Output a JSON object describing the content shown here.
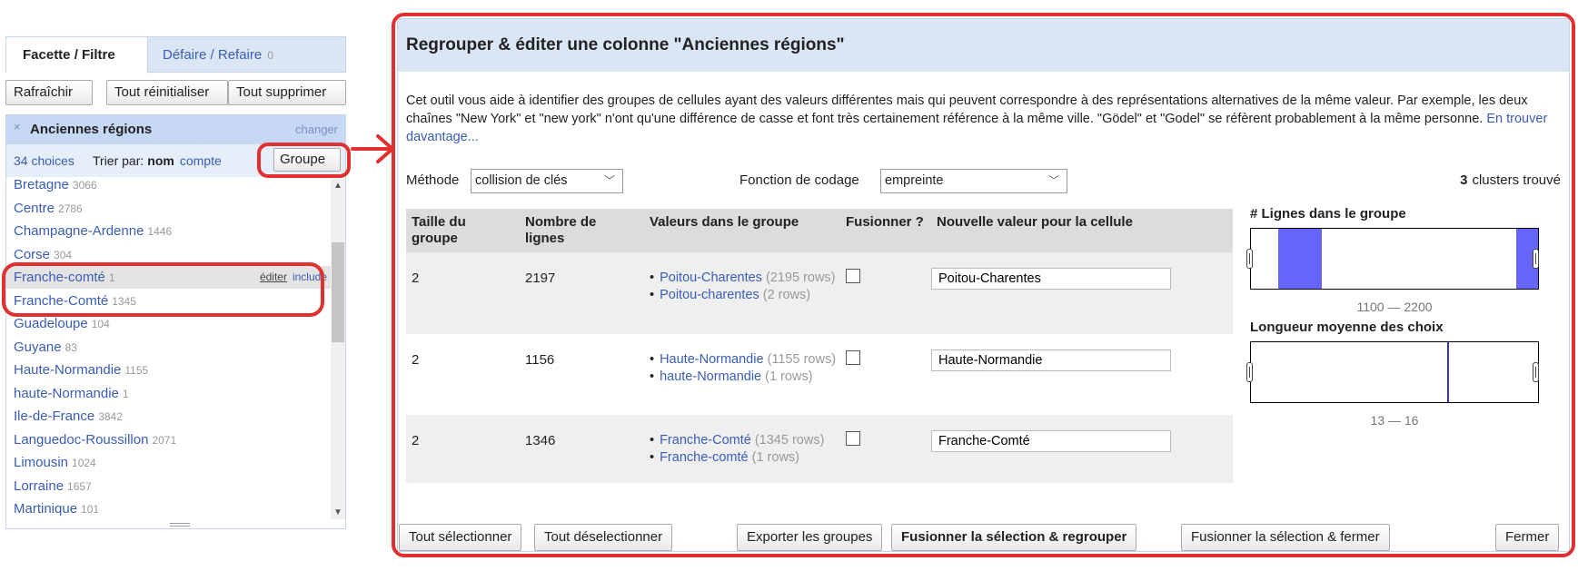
{
  "left_panel": {
    "tabs": {
      "active": "Facette / Filtre",
      "other": "Défaire / Refaire",
      "other_count": "0"
    },
    "buttons": {
      "refresh": "Rafraîchir",
      "reset_all": "Tout réinitialiser",
      "remove_all": "Tout supprimer"
    },
    "facet": {
      "close_icon": "×",
      "title": "Anciennes régions",
      "change": "changer",
      "choices": "34 choices",
      "sort_label": "Trier par:",
      "sort_name": "nom",
      "sort_count": "compte",
      "group_button": "Groupe",
      "items": [
        {
          "label": "Bretagne",
          "count": "3066"
        },
        {
          "label": "Centre",
          "count": "2786"
        },
        {
          "label": "Champagne-Ardenne",
          "count": "1446"
        },
        {
          "label": "Corse",
          "count": "304"
        },
        {
          "label": "Franche-comté",
          "count": "1",
          "edit": "éditer",
          "include": "include"
        },
        {
          "label": "Franche-Comté",
          "count": "1345"
        },
        {
          "label": "Guadeloupe",
          "count": "104"
        },
        {
          "label": "Guyane",
          "count": "83"
        },
        {
          "label": "Haute-Normandie",
          "count": "1155"
        },
        {
          "label": "haute-Normandie",
          "count": "1"
        },
        {
          "label": "Ile-de-France",
          "count": "3842"
        },
        {
          "label": "Languedoc-Roussillon",
          "count": "2071"
        },
        {
          "label": "Limousin",
          "count": "1024"
        },
        {
          "label": "Lorraine",
          "count": "1657"
        },
        {
          "label": "Martinique",
          "count": "101"
        }
      ]
    }
  },
  "dialog": {
    "title": "Regrouper & éditer une colonne \"Anciennes régions\"",
    "description": "Cet outil vous aide à identifier des groupes de cellules ayant des valeurs différentes mais qui peuvent correspondre à des représentations alternatives de la même valeur. Par exemple, les deux chaînes \"New York\" et \"new york\" n'ont qu'une différence de casse et font très certainement référence à la même ville. \"Gödel\" et \"Godel\" se réfèrent probablement à la même personne.",
    "learn_more": "En trouver davantage...",
    "method_label": "Méthode",
    "method_value": "collision de clés",
    "function_label": "Fonction de codage",
    "function_value": "empreinte",
    "clusters_count": "3",
    "clusters_label": "clusters trouvé",
    "columns": [
      "Taille du groupe",
      "Nombre de lignes",
      "Valeurs dans le groupe",
      "Fusionner ?",
      "Nouvelle valeur pour la cellule"
    ],
    "rows": [
      {
        "size": "2",
        "rows_count": "2197",
        "values": [
          {
            "label": "Poitou-Charentes",
            "rows": "(2195 rows)"
          },
          {
            "label": "Poitou-charentes",
            "rows": "(2 rows)"
          }
        ],
        "new_value": "Poitou-Charentes"
      },
      {
        "size": "2",
        "rows_count": "1156",
        "values": [
          {
            "label": "Haute-Normandie",
            "rows": "(1155 rows)"
          },
          {
            "label": "haute-Normandie",
            "rows": "(1 rows)"
          }
        ],
        "new_value": "Haute-Normandie"
      },
      {
        "size": "2",
        "rows_count": "1346",
        "values": [
          {
            "label": "Franche-Comté",
            "rows": "(1345 rows)"
          },
          {
            "label": "Franche-comté",
            "rows": "(1 rows)"
          }
        ],
        "new_value": "Franche-Comté"
      }
    ],
    "histograms": [
      {
        "title": "# Lignes dans le groupe",
        "range": "1100 — 2200"
      },
      {
        "title": "Longueur moyenne des choix",
        "range": "13 — 16"
      }
    ],
    "footer": {
      "select_all": "Tout sélectionner",
      "deselect_all": "Tout déselectionner",
      "export": "Exporter les groupes",
      "merge_recluster": "Fusionner la sélection & regrouper",
      "merge_close": "Fusionner la sélection & fermer",
      "close": "Fermer"
    }
  },
  "colors": {
    "link": "#3a5db4",
    "annotation_red": "#e03030",
    "histogram_bar": "#6666ff",
    "header_bg": "#dbe6f5"
  }
}
